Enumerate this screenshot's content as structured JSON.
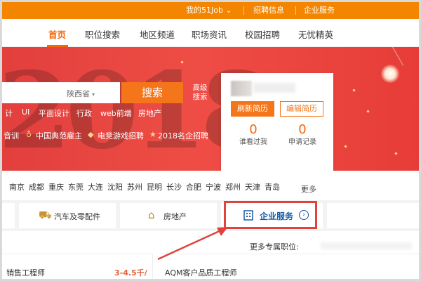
{
  "topbar": {
    "my_51job": "我的51Job",
    "my_51job_caret": "⌄",
    "messages": "招聘信息",
    "enterprise": "企业服务"
  },
  "nav": {
    "items": [
      "首页",
      "职位搜索",
      "地区频道",
      "职场资讯",
      "校园招聘",
      "无忧精英"
    ]
  },
  "banner": {
    "year": "2018",
    "search": {
      "value": "",
      "placeholder": "",
      "city": "陕西省",
      "button": "搜索",
      "advanced": "高级搜索"
    },
    "hotwords": [
      "计",
      "UI",
      "平面设计",
      "行政",
      "web前端",
      "房地产"
    ],
    "promos": [
      "音训",
      "中国典范雇主",
      "电竞游戏招聘",
      "2018名企招聘"
    ]
  },
  "card": {
    "refresh": "刷新简历",
    "edit": "编辑简历",
    "viewed_count": "0",
    "viewed_label": "谁看过我",
    "apply_count": "0",
    "apply_label": "申请记录"
  },
  "cities": {
    "items": [
      "南京",
      "成都",
      "重庆",
      "东莞",
      "大连",
      "沈阳",
      "苏州",
      "昆明",
      "长沙",
      "合肥",
      "宁波",
      "郑州",
      "天津",
      "青岛"
    ],
    "more": "更多"
  },
  "industry": {
    "auto": "汽车及零配件",
    "realestate": "房地产",
    "enterprise": "企业服务"
  },
  "jobs": {
    "more_title": "更多专属职位:",
    "job1_title": "销售工程师",
    "job1_salary": "3-4.5千/月",
    "job2_title": "AQM客户品质工程师"
  },
  "colors": {
    "brand_orange": "#f38500",
    "banner_red": "#e84541",
    "highlight_red": "#e0433c",
    "enterprise_blue": "#1a5aa6"
  }
}
